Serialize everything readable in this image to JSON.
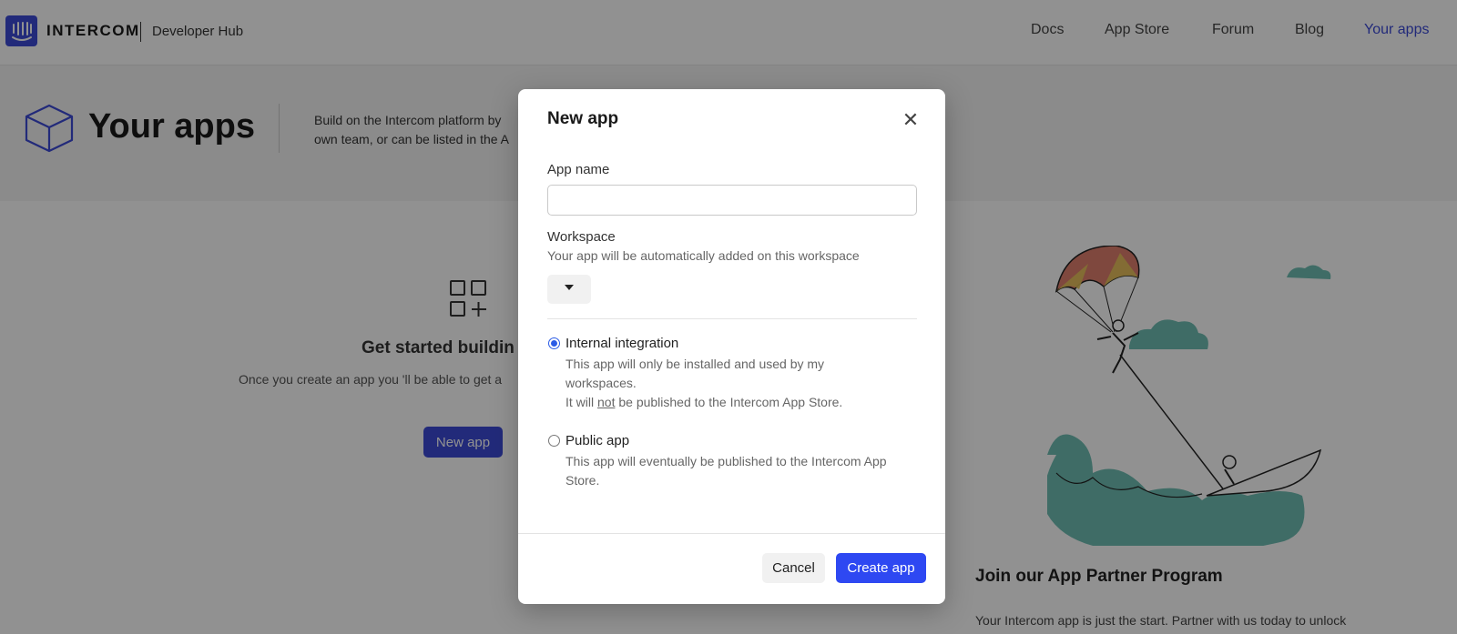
{
  "brand": {
    "name": "INTERCOM",
    "subtitle": "Developer Hub",
    "logo_icon": "intercom-logo-icon"
  },
  "nav": [
    {
      "label": "Docs",
      "active": false
    },
    {
      "label": "App Store",
      "active": false
    },
    {
      "label": "Forum",
      "active": false
    },
    {
      "label": "Blog",
      "active": false
    },
    {
      "label": "Your apps",
      "active": true
    }
  ],
  "hero": {
    "title": "Your apps",
    "desc_line1": "Build on the Intercom platform by",
    "desc_line2": "own team, or can be listed in the A"
  },
  "empty_state": {
    "title": "Get started buildin",
    "desc": "Once you create an app you 'll be able to get a",
    "button": "New app"
  },
  "partner": {
    "title": "Join our App Partner Program",
    "desc": "Your Intercom app is just the start. Partner with us today to unlock"
  },
  "modal": {
    "title": "New app",
    "app_name_label": "App name",
    "app_name_value": "",
    "workspace_label": "Workspace",
    "workspace_hint": "Your app will be automatically added on this workspace",
    "workspace_selected": "",
    "options": [
      {
        "label": "Internal integration",
        "checked": true,
        "desc_line1": "This app will only be installed and used by my",
        "desc_line2": "workspaces.",
        "desc_line3_before": "It will ",
        "desc_line3_emph": "not",
        "desc_line3_after": " be published to the Intercom App Store."
      },
      {
        "label": "Public app",
        "checked": false,
        "desc_line1": "This app will eventually be published to the Intercom App",
        "desc_line2": "Store."
      }
    ],
    "cancel_label": "Cancel",
    "create_label": "Create app"
  },
  "colors": {
    "accent": "#2e48f2",
    "brand": "#3d4bd6",
    "radio": "#2b5ce6"
  }
}
